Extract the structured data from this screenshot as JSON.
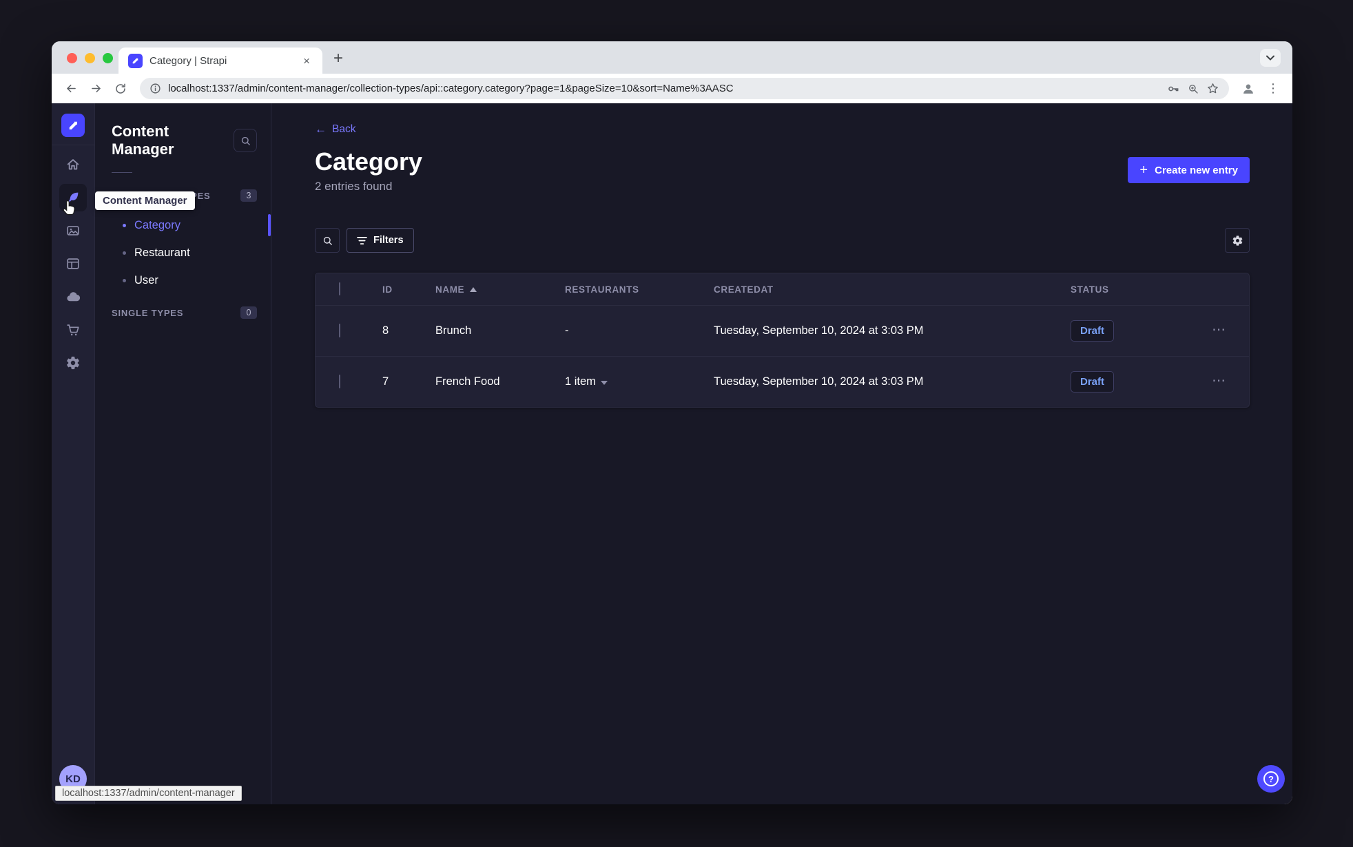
{
  "browser": {
    "tab_title": "Category | Strapi",
    "url": "localhost:1337/admin/content-manager/collection-types/api::category.category?page=1&pageSize=10&sort=Name%3AASC",
    "status_bar": "localhost:1337/admin/content-manager"
  },
  "icons": {
    "close": "×",
    "plus": "+",
    "browser_menu_dots": "⋮",
    "row_dots": "⋯",
    "help": "?",
    "back_arrow": "←"
  },
  "rail": {
    "avatar_initials": "KD"
  },
  "subnav": {
    "title": "Content Manager",
    "tooltip": "Content Manager",
    "sections": [
      {
        "label": "COLLECTION TYPES",
        "count": "3",
        "items": [
          {
            "label": "Category"
          },
          {
            "label": "Restaurant"
          },
          {
            "label": "User"
          }
        ]
      },
      {
        "label": "SINGLE TYPES",
        "count": "0",
        "items": []
      }
    ]
  },
  "main": {
    "back_label": "Back",
    "title": "Category",
    "subtitle": "2 entries found",
    "create_label": "Create new entry",
    "filters_label": "Filters",
    "table": {
      "headers": [
        "ID",
        "NAME",
        "RESTAURANTS",
        "CREATEDAT",
        "STATUS"
      ],
      "rows": [
        {
          "id": "8",
          "name": "Brunch",
          "restaurants": "-",
          "created": "Tuesday, September 10, 2024 at 3:03 PM",
          "status": "Draft"
        },
        {
          "id": "7",
          "name": "French Food",
          "restaurants": "1 item",
          "created": "Tuesday, September 10, 2024 at 3:03 PM",
          "status": "Draft"
        }
      ]
    }
  },
  "colors": {
    "primary": "#4945ff",
    "link": "#7b79ff",
    "draft_text": "#7aa1f7",
    "app_bg": "#181826",
    "panel_bg": "#212134"
  }
}
